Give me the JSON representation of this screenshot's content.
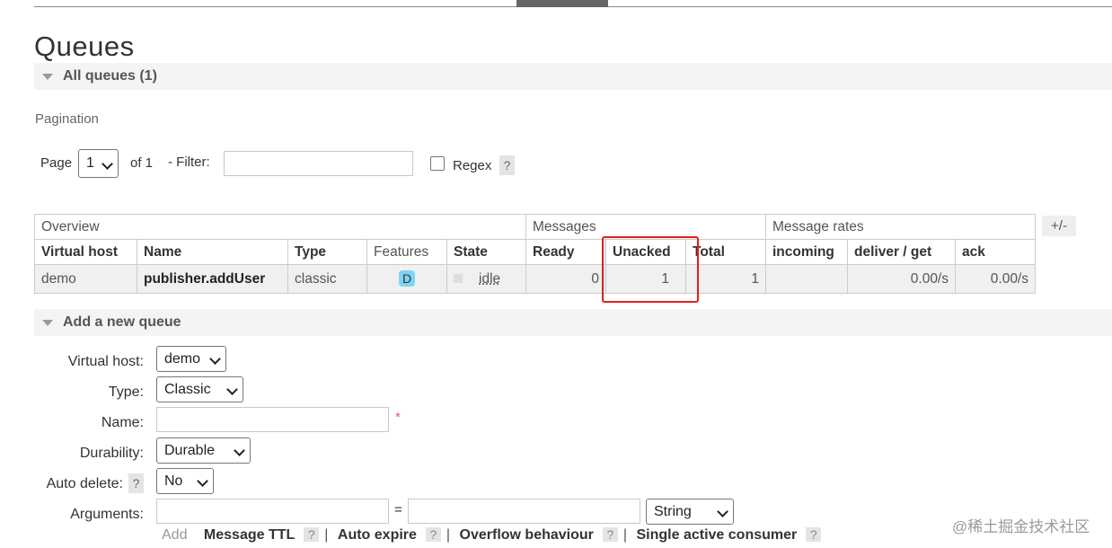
{
  "page": {
    "title": "Queues"
  },
  "all_queues": {
    "label": "All queues (1)"
  },
  "pagination": {
    "label": "Pagination",
    "page_label": "Page",
    "page_value": "1",
    "of_label": "of 1",
    "filter_label": "- Filter:",
    "filter_value": "",
    "regex_label": "Regex",
    "help": "?"
  },
  "table": {
    "groups": [
      "Overview",
      "Messages",
      "Message rates"
    ],
    "columns": [
      "Virtual host",
      "Name",
      "Type",
      "Features",
      "State",
      "Ready",
      "Unacked",
      "Total",
      "incoming",
      "deliver / get",
      "ack"
    ],
    "toggle_label": "+/-",
    "rows": [
      {
        "vhost": "demo",
        "name": "publisher.addUser",
        "type": "classic",
        "feature": "D",
        "state": "idle",
        "ready": "0",
        "unacked": "1",
        "total": "1",
        "incoming": "",
        "deliver_get": "0.00/s",
        "ack": "0.00/s"
      }
    ]
  },
  "add_queue": {
    "label": "Add a new queue",
    "vhost_label": "Virtual host:",
    "vhost_value": "demo",
    "type_label": "Type:",
    "type_value": "Classic",
    "name_label": "Name:",
    "name_value": "",
    "required_mark": "*",
    "durability_label": "Durability:",
    "durability_value": "Durable",
    "auto_delete_label": "Auto delete:",
    "auto_delete_value": "No",
    "arguments_label": "Arguments:",
    "equals": "=",
    "arg_type_value": "String",
    "add_label": "Add",
    "help": "?",
    "separator": "|",
    "links": [
      "Message TTL",
      "Auto expire",
      "Overflow behaviour",
      "Single active consumer"
    ]
  },
  "watermark": "@稀土掘金技术社区",
  "colors": {
    "highlight": "#e0201a",
    "feature_badge": "#7fd4f5"
  }
}
